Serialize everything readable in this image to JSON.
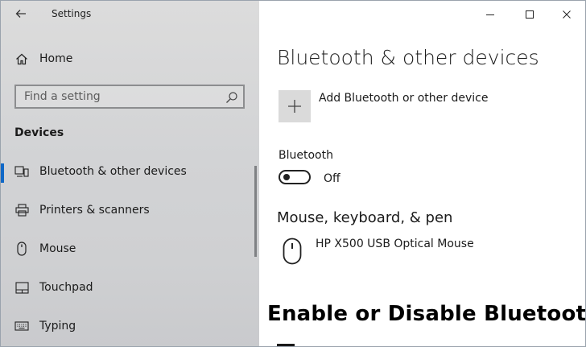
{
  "window": {
    "title": "Settings",
    "controls": {
      "minimize": "minimize-icon",
      "maximize": "maximize-icon",
      "close": "close-icon"
    }
  },
  "sidebar": {
    "home_label": "Home",
    "search": {
      "placeholder": "Find a setting",
      "icon": "search-icon"
    },
    "section_label": "Devices",
    "items": [
      {
        "label": "Bluetooth & other devices",
        "icon": "bluetooth-devices-icon",
        "selected": true
      },
      {
        "label": "Printers & scanners",
        "icon": "printer-icon",
        "selected": false
      },
      {
        "label": "Mouse",
        "icon": "mouse-icon",
        "selected": false
      },
      {
        "label": "Touchpad",
        "icon": "touchpad-icon",
        "selected": false
      },
      {
        "label": "Typing",
        "icon": "keyboard-icon",
        "selected": false
      }
    ]
  },
  "main": {
    "page_title": "Bluetooth & other devices",
    "add_device_label": "Add Bluetooth or other device",
    "bluetooth_label": "Bluetooth",
    "bluetooth_state": "Off",
    "section_title": "Mouse, keyboard, & pen",
    "device_name": "HP X500 USB Optical Mouse"
  },
  "overlay": {
    "caption": "Enable or Disable Bluetooth"
  },
  "colors": {
    "accent": "#1068c7",
    "sidebar_bg": "#d4d5d7"
  }
}
